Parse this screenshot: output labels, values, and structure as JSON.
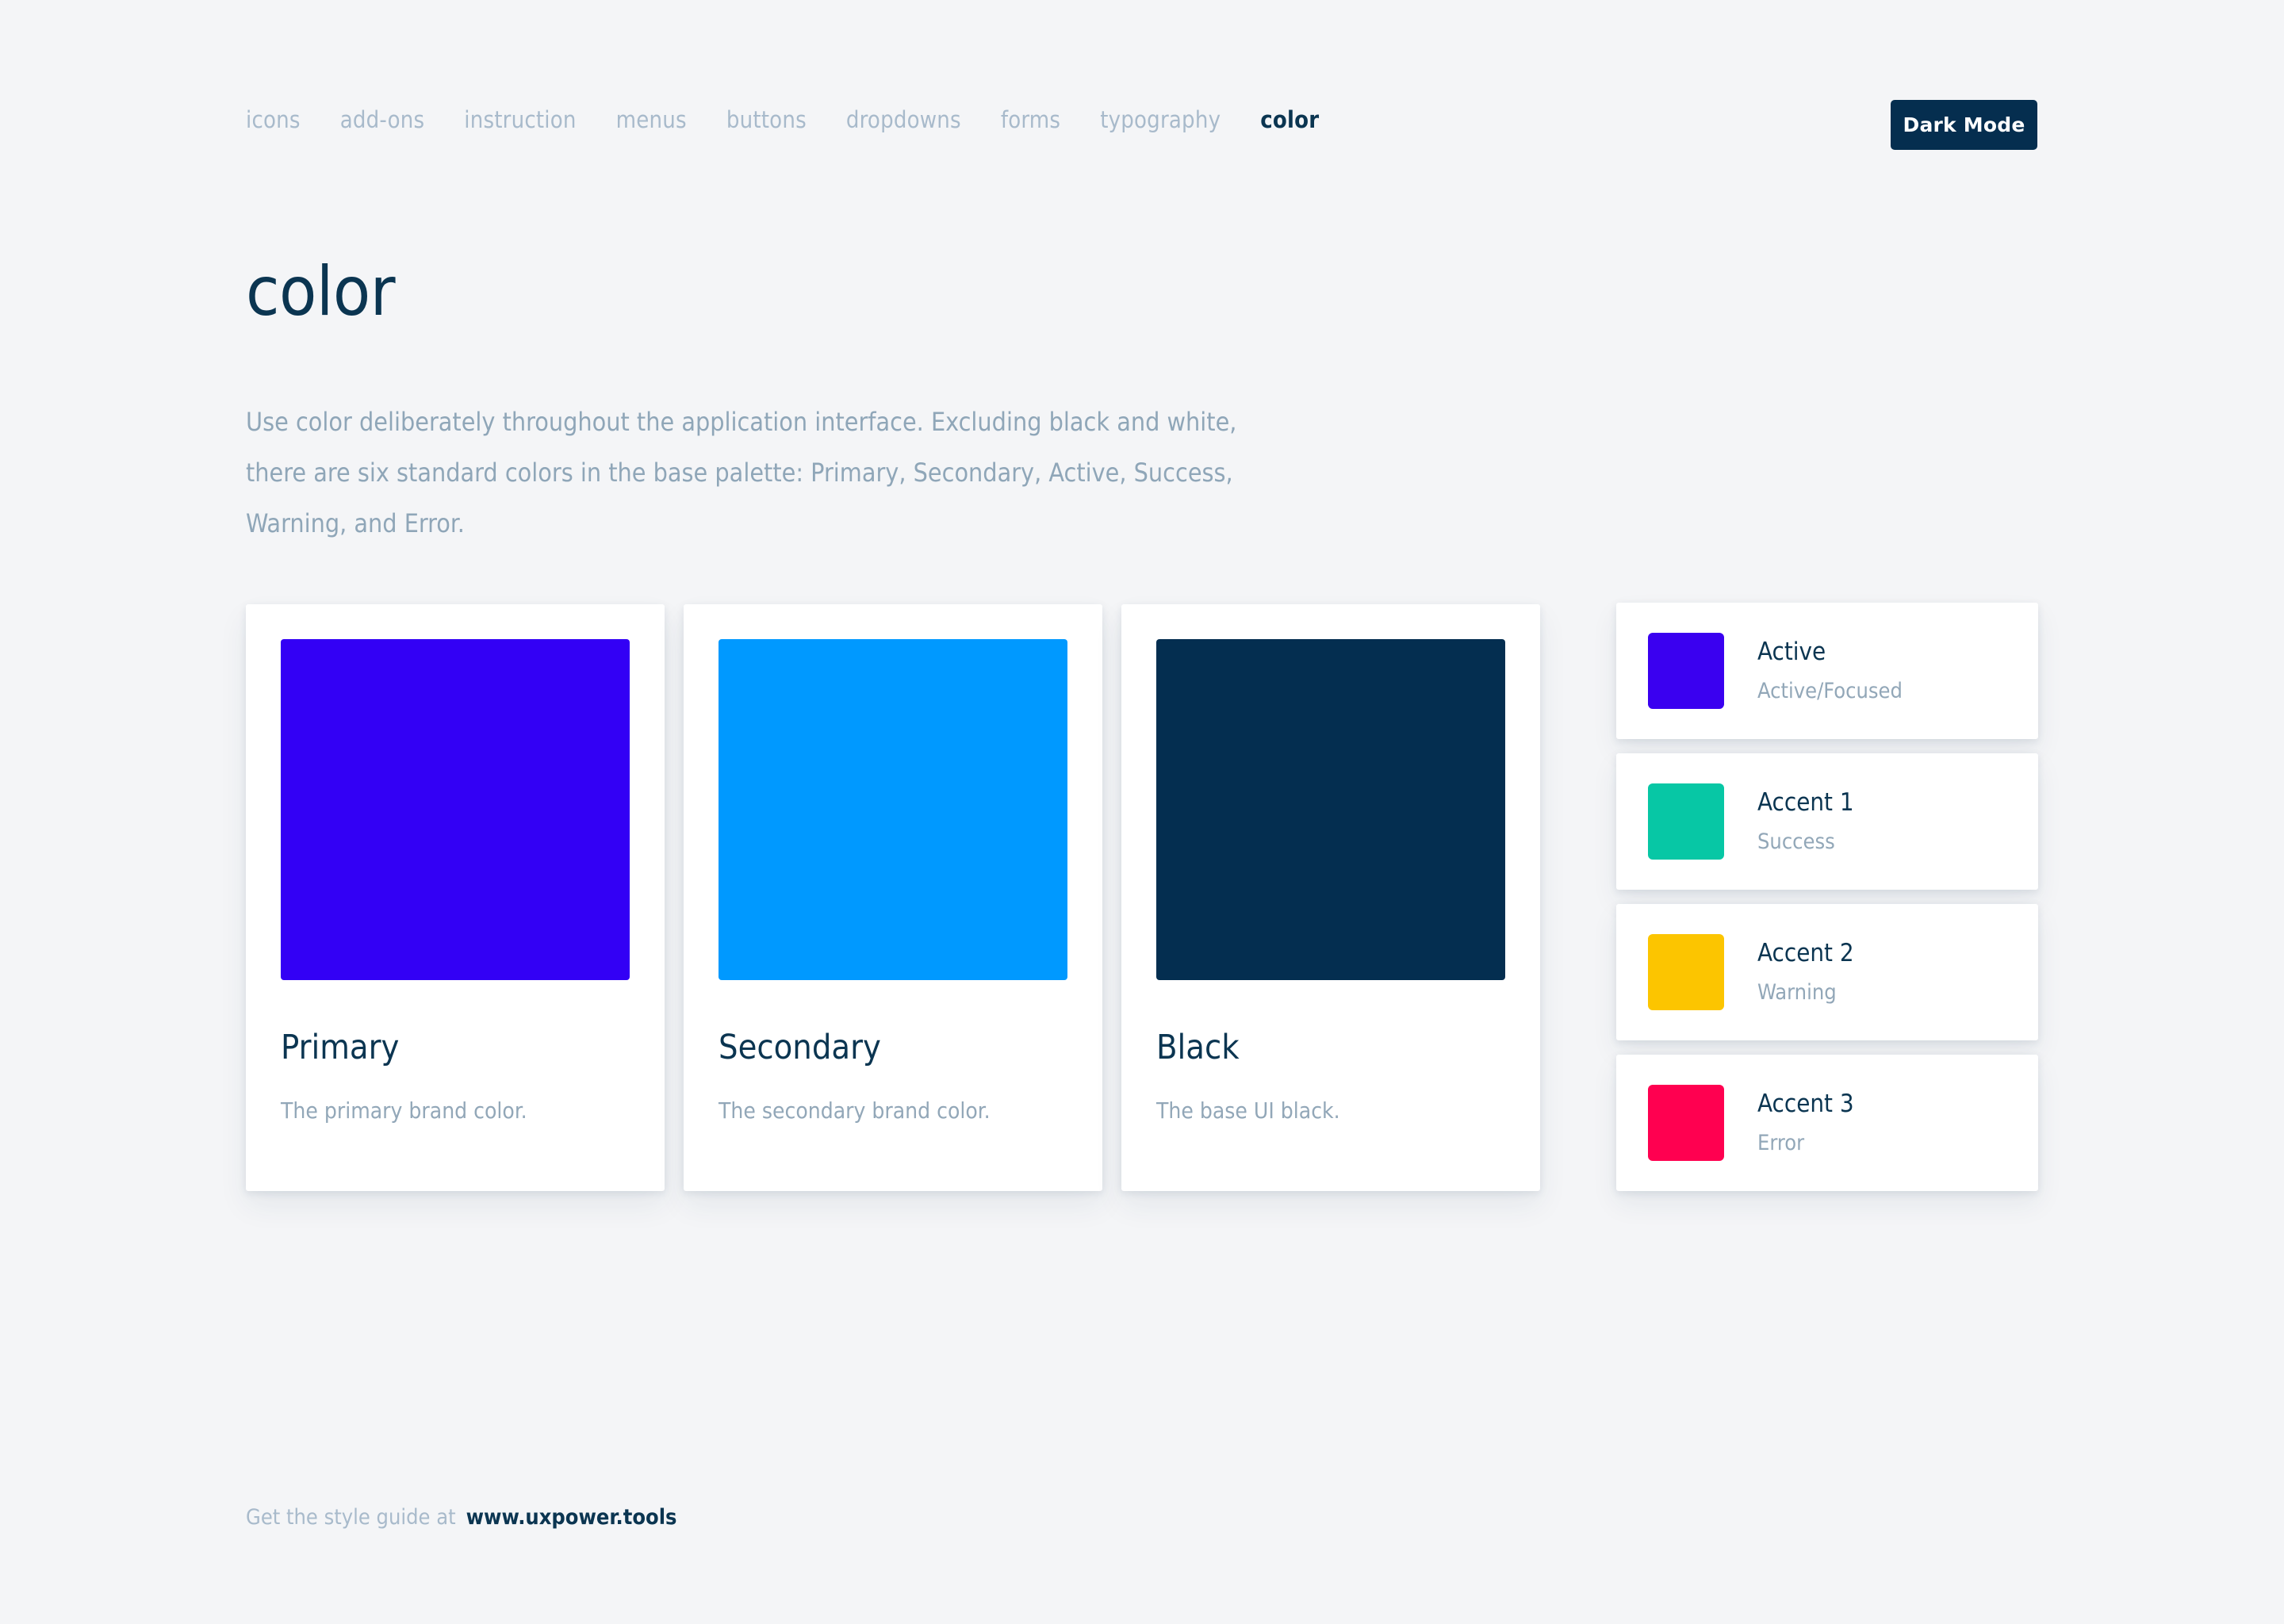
{
  "nav": {
    "items": [
      {
        "label": "icons",
        "active": false
      },
      {
        "label": "add-ons",
        "active": false
      },
      {
        "label": "instruction",
        "active": false
      },
      {
        "label": "menus",
        "active": false
      },
      {
        "label": "buttons",
        "active": false
      },
      {
        "label": "dropdowns",
        "active": false
      },
      {
        "label": "forms",
        "active": false
      },
      {
        "label": "typography",
        "active": false
      },
      {
        "label": "color",
        "active": true
      }
    ],
    "dark_mode_label": "Dark Mode"
  },
  "header": {
    "title": "color",
    "intro": "Use color deliberately throughout the application interface. Excluding black and white, there are six standard colors in the base palette: Primary, Secondary, Active, Success, Warning, and Error."
  },
  "main_colors": [
    {
      "name": "Primary",
      "description": "The primary brand color.",
      "hex": "#3300f5"
    },
    {
      "name": "Secondary",
      "description": "The secondary brand color.",
      "hex": "#0099ff"
    },
    {
      "name": "Black",
      "description": "The base UI black.",
      "hex": "#042e50"
    }
  ],
  "accent_colors": [
    {
      "name": "Active",
      "usage": "Active/Focused",
      "hex": "#3a00f0"
    },
    {
      "name": "Accent 1",
      "usage": "Success",
      "hex": "#07c7a5"
    },
    {
      "name": "Accent 2",
      "usage": "Warning",
      "hex": "#fcc500"
    },
    {
      "name": "Accent 3",
      "usage": "Error",
      "hex": "#ff0050"
    }
  ],
  "footer": {
    "text": "Get the style guide at",
    "link": "www.uxpower.tools"
  },
  "theme": {
    "page_background": "#f4f5f7",
    "card_background": "#ffffff",
    "heading_color": "#0b3551",
    "muted_text": "#92a7b8",
    "nav_inactive": "#a8bacb",
    "dark_button": "#052e4f"
  }
}
